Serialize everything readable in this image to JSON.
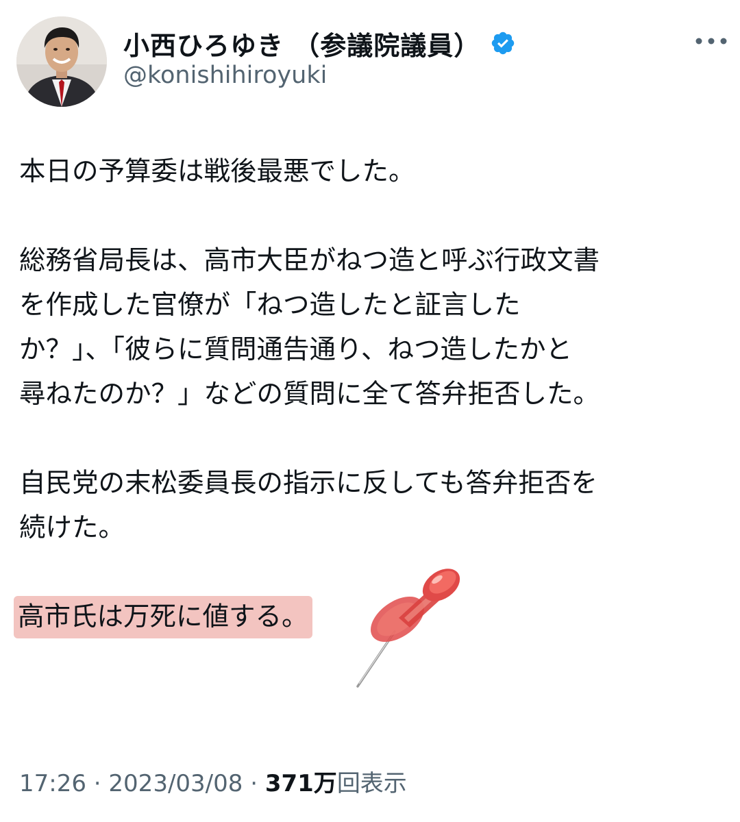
{
  "author": {
    "display_name": "小西ひろゆき （参議院議員）",
    "handle": "@konishihiroyuki",
    "verified": true,
    "avatar_icon": "portrait-photo"
  },
  "tweet": {
    "paragraphs": [
      {
        "lines": [
          "本日の予算委は戦後最悪でした。"
        ]
      },
      {
        "lines": [
          "総務省局長は、高市大臣がねつ造と呼ぶ行政文書",
          "を作成した官僚が「ねつ造したと証言した",
          "か？」、「彼らに質問通告通り、ねつ造したかと",
          "尋ねたのか？」などの質問に全て答弁拒否した。"
        ]
      },
      {
        "lines": [
          "自民党の末松委員長の指示に反しても答弁拒否を",
          "続けた。"
        ]
      }
    ],
    "highlighted_sentence": "高市氏は万死に値する。",
    "time": "17:26",
    "separator": "·",
    "date": "2023/03/08",
    "views_count": "371万",
    "views_label": "回表示"
  },
  "annotation": {
    "icon": "pushpin-icon",
    "highlight_color": "#f3c4c0"
  },
  "colors": {
    "text": "#0f1419",
    "secondary": "#536471",
    "verified": "#1d9bf0"
  }
}
